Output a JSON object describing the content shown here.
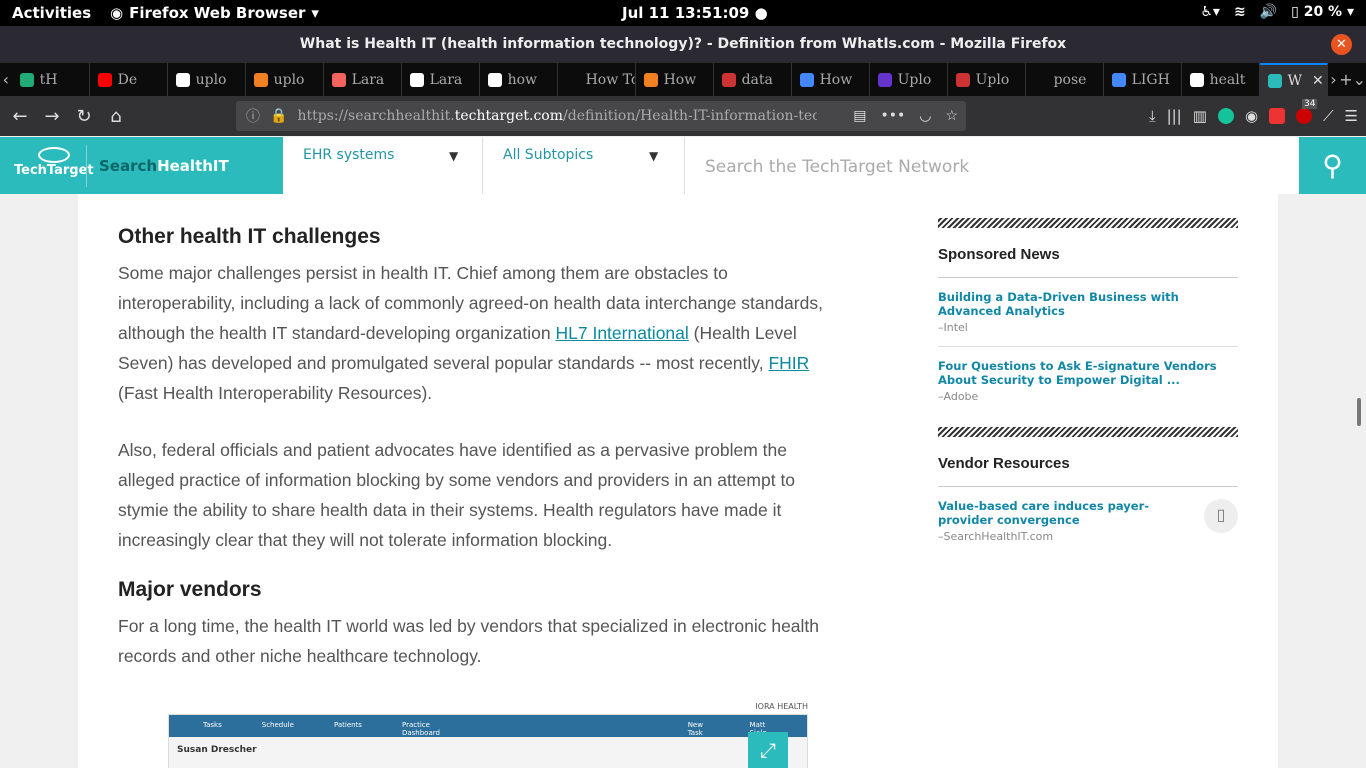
{
  "system": {
    "activities": "Activities",
    "app_name": "Firefox Web Browser",
    "clock": "Jul 11  13:51:09",
    "battery": "20 %"
  },
  "window": {
    "title": "What is Health IT (health information technology)? - Definition from WhatIs.com - Mozilla Firefox"
  },
  "tabs": [
    {
      "label": "tH",
      "color": "#2a7"
    },
    {
      "label": "De",
      "color": "#f00"
    },
    {
      "label": "uplo",
      "color": "#fff"
    },
    {
      "label": "uplo",
      "color": "#f48024"
    },
    {
      "label": "Lara",
      "color": "#f4645f"
    },
    {
      "label": "Lara",
      "color": "#fff"
    },
    {
      "label": "how",
      "color": "#fff"
    },
    {
      "label": "How To",
      "color": ""
    },
    {
      "label": "How",
      "color": "#f48024"
    },
    {
      "label": "data",
      "color": "#c33"
    },
    {
      "label": "How",
      "color": "#48f"
    },
    {
      "label": "Uplo",
      "color": "#63c"
    },
    {
      "label": "Uplo",
      "color": "#c33"
    },
    {
      "label": "pose",
      "color": ""
    },
    {
      "label": "LIGH",
      "color": "#48f"
    },
    {
      "label": "healt",
      "color": "#fff"
    },
    {
      "label": "W",
      "color": "#2cbbbc"
    }
  ],
  "url": {
    "prefix": "https://searchhealthit.",
    "domain": "techtarget.com",
    "path": "/definition/Health-IT-information-techn"
  },
  "extensions": {
    "abp_badge": "34"
  },
  "site": {
    "brand": "TechTarget",
    "search_prefix": "Search",
    "search_suffix": "HealthIT",
    "dropdown1": "EHR systems",
    "dropdown2": "All Subtopics",
    "search_placeholder": "Search the TechTarget Network"
  },
  "article": {
    "h1": "Other health IT challenges",
    "p1a": "Some major challenges persist in health IT. Chief among them are obstacles to interoperability, including a lack of commonly agreed-on health data interchange standards, although the health IT standard-developing organization ",
    "p1_link1": "HL7 International",
    "p1b": " (Health Level Seven) has developed and promulgated several popular standards -- most recently, ",
    "p1_link2": "FHIR",
    "p1c": " (Fast Health Interoperability Resources).",
    "p2": "Also, federal officials and patient advocates have identified as a pervasive problem the alleged practice of information blocking by some vendors and providers in an attempt to stymie the ability to share health data in their systems. Health regulators have made it increasingly clear that they will not tolerate information blocking.",
    "h2": "Major vendors",
    "p3": "For a long time, the health IT world was led by vendors that specialized in electronic health records and other niche healthcare technology.",
    "figure_credit": "IORA HEALTH",
    "figure_tabs": [
      "Tasks",
      "Schedule",
      "Patients",
      "Practice Dashboard",
      "New Task",
      "Matt Sielo"
    ],
    "figure_patient": "Susan Drescher"
  },
  "sidebar": {
    "sponsored_title": "Sponsored News",
    "sponsored": [
      {
        "title": "Building a Data-Driven Business with Advanced Analytics",
        "source": "–Intel"
      },
      {
        "title": "Four Questions to Ask E-signature Vendors About Security to Empower Digital ...",
        "source": "–Adobe"
      }
    ],
    "vendor_title": "Vendor Resources",
    "vendor": [
      {
        "title": "Value-based care induces payer-provider convergence",
        "source": "–SearchHealthIT.com"
      }
    ]
  }
}
